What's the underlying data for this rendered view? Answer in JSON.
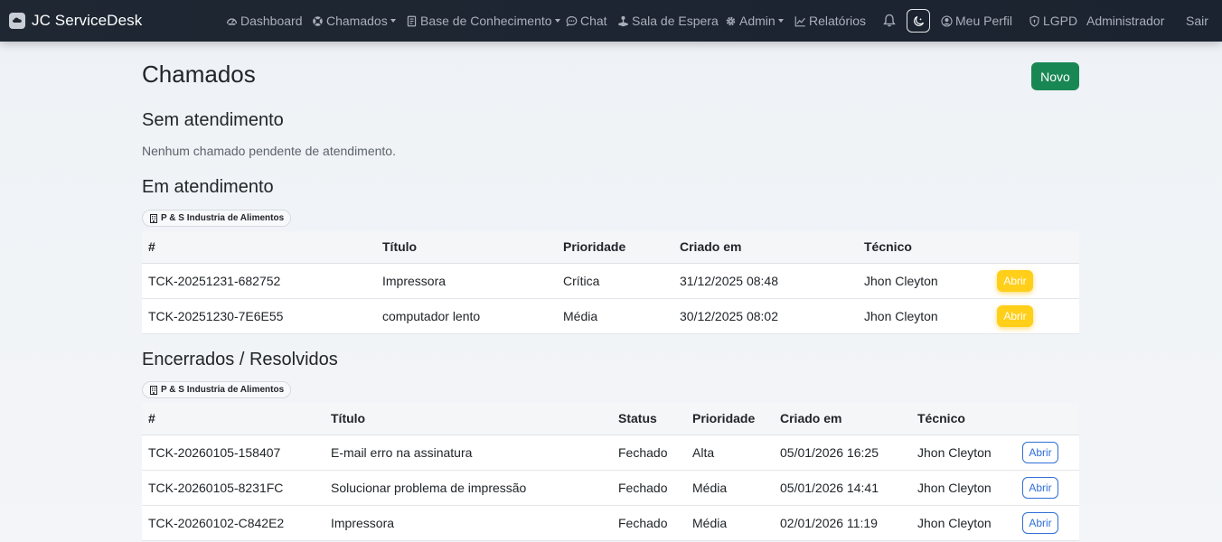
{
  "navbar": {
    "brand": "JC ServiceDesk",
    "links": [
      {
        "label": "Dashboard",
        "icon": "speedometer-icon"
      },
      {
        "label": "Chamados",
        "icon": "life-ring-icon",
        "dropdown": true
      },
      {
        "label": "Base de Conhecimento",
        "icon": "journal-icon",
        "dropdown": true
      },
      {
        "label": "Chat",
        "icon": "chat-icon"
      },
      {
        "label": "Sala de Espera",
        "icon": "joystick-icon"
      },
      {
        "label": "Admin",
        "icon": "gear-icon",
        "dropdown": true
      },
      {
        "label": "Relatórios",
        "icon": "graph-icon"
      }
    ],
    "profile": "Meu Perfil",
    "lgpd": "LGPD",
    "user": "Administrador",
    "logout": "Sair"
  },
  "page": {
    "title": "Chamados",
    "new_button": "Novo"
  },
  "sem_atendimento": {
    "title": "Sem atendimento",
    "empty_text": "Nenhum chamado pendente de atendimento."
  },
  "em_atendimento": {
    "title": "Em atendimento",
    "company": "P & S Industria de Alimentos",
    "columns": [
      "#",
      "Título",
      "Prioridade",
      "Criado em",
      "Técnico"
    ],
    "rows": [
      {
        "id": "TCK-20251231-682752",
        "titulo": "Impressora",
        "prioridade": "Crítica",
        "criado": "31/12/2025 08:48",
        "tecnico": "Jhon Cleyton",
        "action": "Abrir"
      },
      {
        "id": "TCK-20251230-7E6E55",
        "titulo": "computador lento",
        "prioridade": "Média",
        "criado": "30/12/2025 08:02",
        "tecnico": "Jhon Cleyton",
        "action": "Abrir"
      }
    ]
  },
  "encerrados": {
    "title": "Encerrados / Resolvidos",
    "company": "P & S Industria de Alimentos",
    "columns": [
      "#",
      "Título",
      "Status",
      "Prioridade",
      "Criado em",
      "Técnico"
    ],
    "rows": [
      {
        "id": "TCK-20260105-158407",
        "titulo": "E-mail erro na assinatura",
        "status": "Fechado",
        "prioridade": "Alta",
        "criado": "05/01/2026 16:25",
        "tecnico": "Jhon Cleyton",
        "action": "Abrir"
      },
      {
        "id": "TCK-20260105-8231FC",
        "titulo": "Solucionar problema de impressão",
        "status": "Fechado",
        "prioridade": "Média",
        "criado": "05/01/2026 14:41",
        "tecnico": "Jhon Cleyton",
        "action": "Abrir"
      },
      {
        "id": "TCK-20260102-C842E2",
        "titulo": "Impressora",
        "status": "Fechado",
        "prioridade": "Média",
        "criado": "02/01/2026 11:19",
        "tecnico": "Jhon Cleyton",
        "action": "Abrir"
      }
    ]
  },
  "colors": {
    "navbar_bg": "#1f2733",
    "success": "#198754",
    "warning": "#ffcf1a",
    "primary": "#2f6fd6"
  }
}
